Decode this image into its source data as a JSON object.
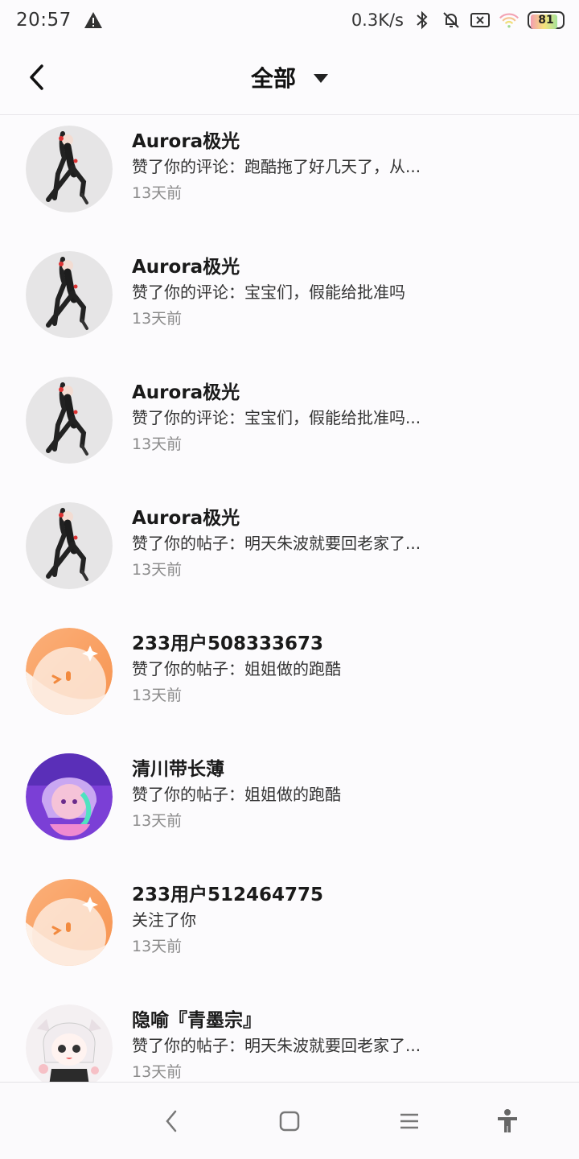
{
  "status_bar": {
    "time": "20:57",
    "net_speed": "0.3K/s",
    "battery": "81",
    "icons": [
      "warning-icon",
      "bluetooth-icon",
      "bell-muted-icon",
      "sim-off-icon",
      "wifi-icon",
      "battery-icon"
    ]
  },
  "header": {
    "title": "全部",
    "back_icon": "chevron-left-icon",
    "dropdown_icon": "caret-down-icon"
  },
  "notifications": [
    {
      "name": "Aurora极光",
      "desc": "赞了你的评论：跑酷拖了好几天了，从...",
      "time": "13天前",
      "avatar": "anime-character-avatar"
    },
    {
      "name": "Aurora极光",
      "desc": "赞了你的评论：宝宝们，假能给批准吗",
      "time": "13天前",
      "avatar": "anime-character-avatar"
    },
    {
      "name": "Aurora极光",
      "desc": "赞了你的评论：宝宝们，假能给批准吗...",
      "time": "13天前",
      "avatar": "anime-character-avatar"
    },
    {
      "name": "Aurora极光",
      "desc": "赞了你的帖子：明天朱波就要回老家了...",
      "time": "13天前",
      "avatar": "anime-character-avatar"
    },
    {
      "name": "233用户508333673",
      "desc": "赞了你的帖子：姐姐做的跑酷",
      "time": "13天前",
      "avatar": "default-orange-avatar"
    },
    {
      "name": "清川带长薄",
      "desc": "赞了你的帖子：姐姐做的跑酷",
      "time": "13天前",
      "avatar": "purple-anime-avatar"
    },
    {
      "name": "233用户512464775",
      "desc": "关注了你",
      "time": "13天前",
      "avatar": "default-orange-avatar"
    },
    {
      "name": "隐喻『青墨宗』",
      "desc": "赞了你的帖子：明天朱波就要回老家了...",
      "time": "13天前",
      "avatar": "chibi-anime-avatar"
    }
  ],
  "navbar": {
    "icons": [
      "back-nav-icon",
      "home-nav-icon",
      "menu-nav-icon",
      "accessibility-icon"
    ]
  },
  "colors": {
    "background": "#fcfbfd",
    "orange_avatar": "#f9a36a",
    "purple_avatar": "#7b3fd6"
  }
}
